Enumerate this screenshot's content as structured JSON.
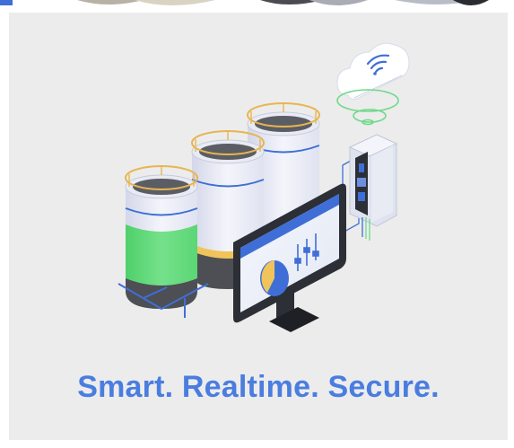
{
  "tagline": "Smart. Realtime. Secure.",
  "colors": {
    "card_background": "#ececec",
    "accent_blue": "#4a7de0",
    "tank_white": "#eef0f7",
    "tank_shadow": "#cfd2e8",
    "liquid_green": "#62dc7a",
    "liquid_gold": "#f0c45a",
    "tank_dark": "#4d4f55",
    "ring_gold": "#e7b551",
    "signal_green": "#6fd98a",
    "monitor_frame": "#2d2f36"
  },
  "icons": {
    "cloud": "cloud-wifi-icon",
    "signal": "wireless-signal-icon",
    "monitor": "monitor-icon",
    "sliders": "sliders-icon",
    "pie": "pie-chart-icon",
    "panel": "control-panel-icon"
  }
}
